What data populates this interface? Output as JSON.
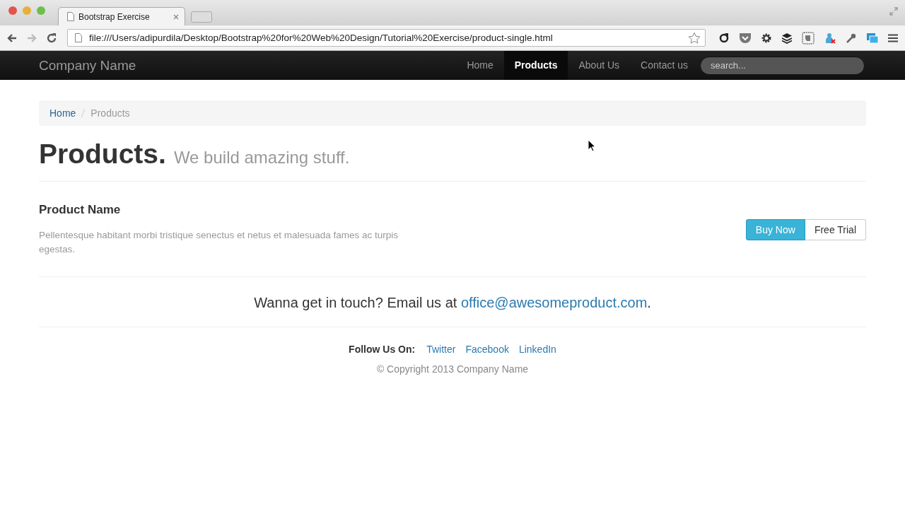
{
  "browser": {
    "tabs": [
      {
        "title": "Bootstrap Exercise",
        "selected": true
      }
    ],
    "url": "file:///Users/adipurdila/Desktop/Bootstrap%20for%20Web%20Design/Tutorial%20Exercise/product-single.html"
  },
  "navbar": {
    "brand": "Company Name",
    "items": [
      {
        "label": "Home",
        "selected": false
      },
      {
        "label": "Products",
        "selected": true
      },
      {
        "label": "About Us",
        "selected": false
      },
      {
        "label": "Contact us",
        "selected": false
      }
    ],
    "search": {
      "placeholder": "search..."
    }
  },
  "breadcrumb": [
    {
      "label": "Home",
      "kind": "link"
    },
    {
      "label": "Products",
      "kind": "current"
    }
  ],
  "header": {
    "title": "Products.",
    "subtitle": "We build amazing stuff."
  },
  "product": {
    "name": "Product Name",
    "description": "Pellentesque habitant morbi tristique senectus et netus et malesuada fames ac turpis egestas.",
    "buttons": [
      {
        "label": "Buy Now",
        "kind": "primary"
      },
      {
        "label": "Free Trial",
        "kind": "default"
      }
    ]
  },
  "contact": {
    "text": "Wanna get in touch? Email us at ",
    "email": "office@awesomeproduct.com",
    "end": "."
  },
  "footer": {
    "follow_label": "Follow Us On:",
    "links": [
      "Twitter",
      "Facebook",
      "LinkedIn"
    ],
    "copyright": "© Copyright 2013 Company Name"
  }
}
